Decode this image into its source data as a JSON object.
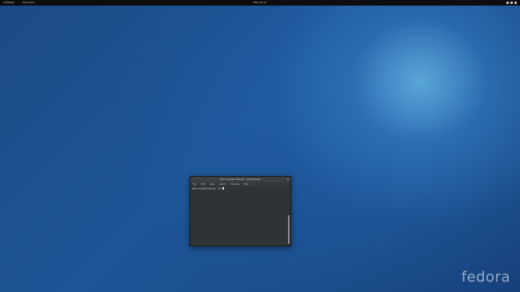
{
  "topbar": {
    "activities_label": "Activities",
    "app_menu_label": "Terminal ▾",
    "clock": "Wed 10:41",
    "tray_icons": [
      "network-icon",
      "volume-icon",
      "power-icon"
    ]
  },
  "terminal": {
    "title": "phoronix@localhost:~/Downloads",
    "menu": [
      "File",
      "Edit",
      "View",
      "Search",
      "Terminal",
      "Help"
    ],
    "prompt": "[phoronix@localhost ~]$ "
  },
  "desktop": {
    "logo_text": "fedora"
  }
}
